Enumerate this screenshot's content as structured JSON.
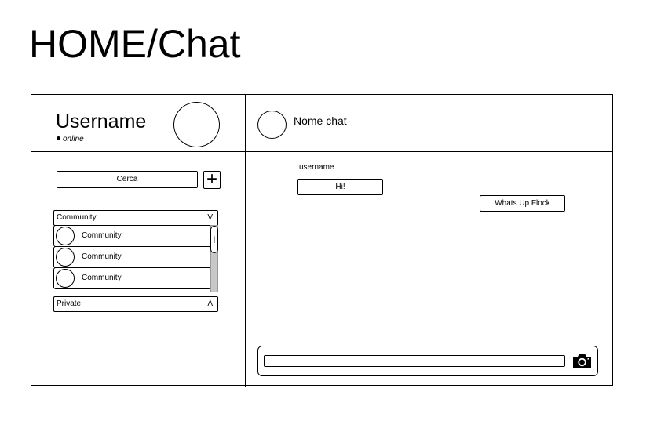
{
  "page": {
    "title": "HOME/Chat"
  },
  "sidebar": {
    "username": "Username",
    "status": "online",
    "search_label": "Cerca",
    "add_label": "+",
    "sections": [
      {
        "label": "Community",
        "arrow": "V"
      },
      {
        "label": "Private",
        "arrow": "Λ"
      }
    ],
    "community_items": [
      {
        "label": "Community"
      },
      {
        "label": "Community"
      },
      {
        "label": "Community"
      }
    ],
    "scroll_grip": "|"
  },
  "chat": {
    "name": "Nome chat",
    "messages": [
      {
        "user": "username",
        "text": "Hi!"
      },
      {
        "text": "Whats Up Flock"
      }
    ],
    "input": {
      "value": "",
      "placeholder": ""
    }
  },
  "icons": {
    "camera": "camera-icon",
    "avatar": "avatar-circle"
  }
}
